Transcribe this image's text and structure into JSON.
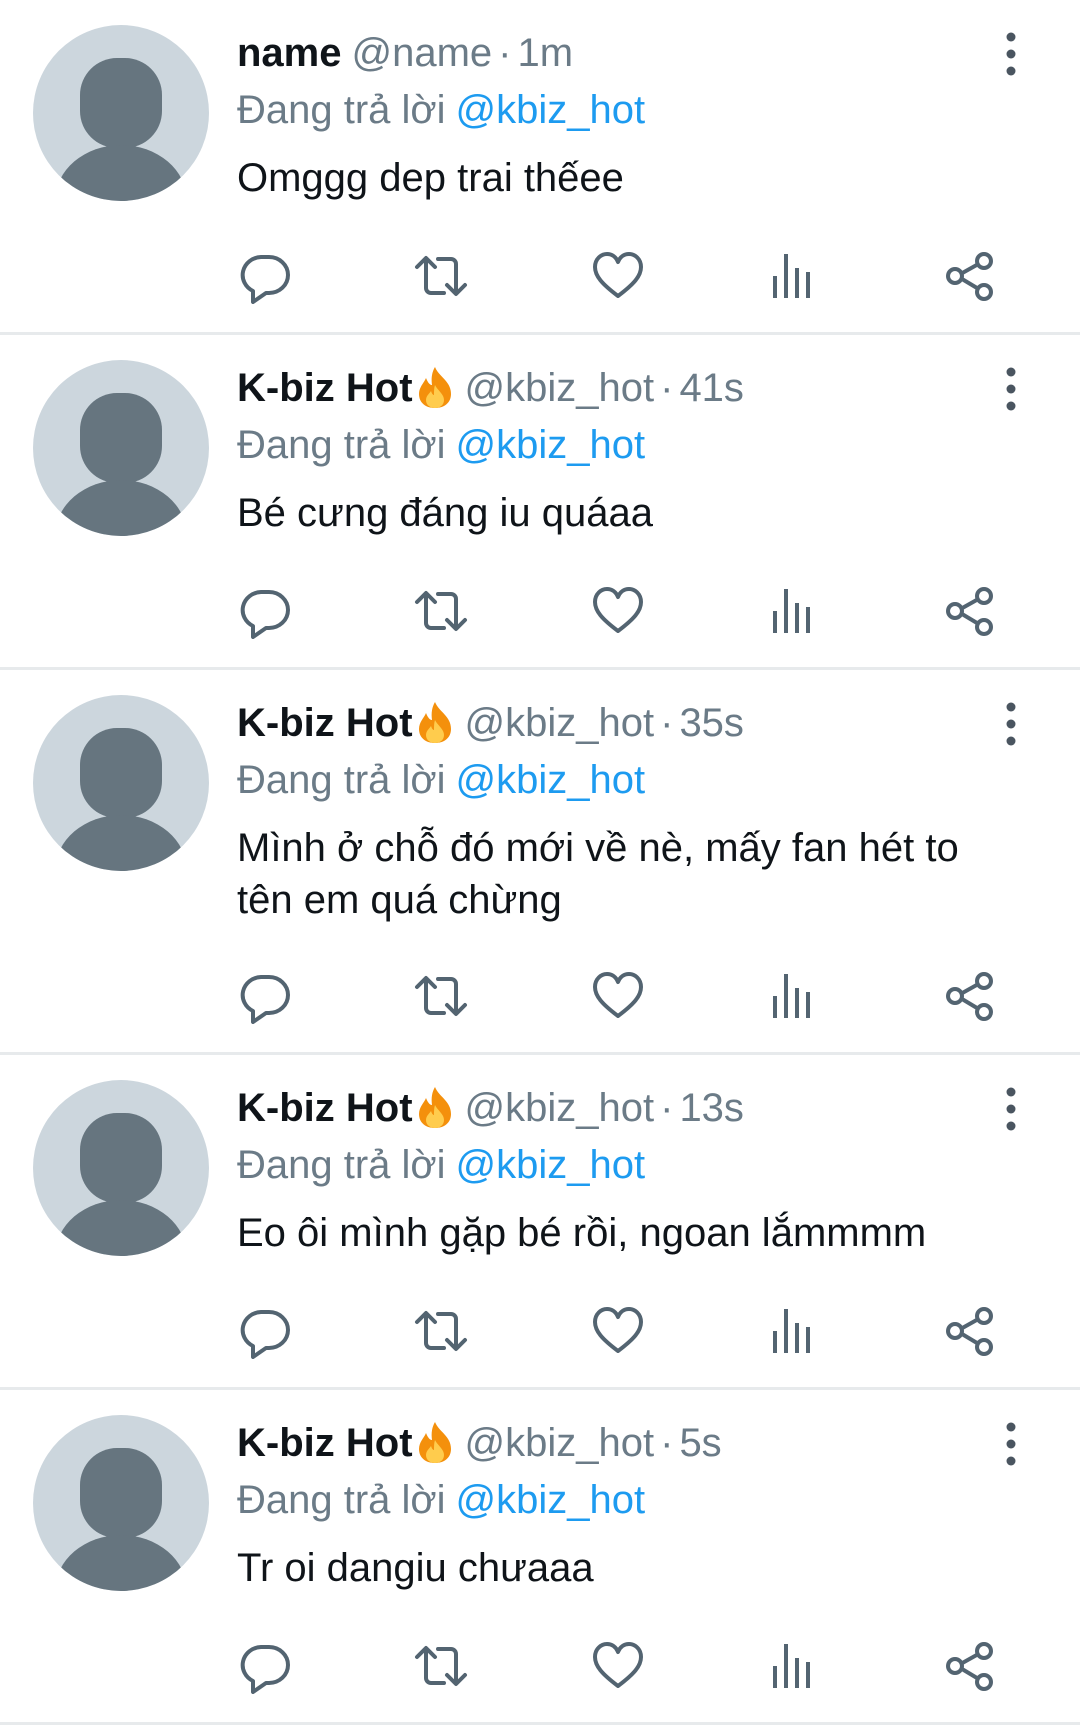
{
  "tweets": [
    {
      "display_name": "name",
      "has_fire": false,
      "handle": "@name",
      "separator": "·",
      "time": "1m",
      "reply_prefix": "Đang trả lời",
      "reply_to": "@kbiz_hot",
      "text": "Omggg dep trai thếee"
    },
    {
      "display_name": "K-biz Hot",
      "has_fire": true,
      "handle": "@kbiz_hot",
      "separator": "·",
      "time": "41s",
      "reply_prefix": "Đang trả lời",
      "reply_to": "@kbiz_hot",
      "text": "Bé cưng đáng iu quáaa"
    },
    {
      "display_name": "K-biz Hot",
      "has_fire": true,
      "handle": "@kbiz_hot",
      "separator": "·",
      "time": "35s",
      "reply_prefix": "Đang trả lời",
      "reply_to": "@kbiz_hot",
      "text": "Mình ở chỗ đó mới về nè, mấy fan hét to tên em quá chừng"
    },
    {
      "display_name": "K-biz Hot",
      "has_fire": true,
      "handle": "@kbiz_hot",
      "separator": "·",
      "time": "13s",
      "reply_prefix": "Đang trả lời",
      "reply_to": "@kbiz_hot",
      "text": "Eo ôi mình gặp bé rồi, ngoan lắmmmm"
    },
    {
      "display_name": "K-biz Hot",
      "has_fire": true,
      "handle": "@kbiz_hot",
      "separator": "·",
      "time": "5s",
      "reply_prefix": "Đang trả lời",
      "reply_to": "@kbiz_hot",
      "text": "Tr oi dangiu chưaaa"
    }
  ],
  "icons": {
    "avatar": "default-avatar-icon",
    "fire": "fire-emoji-icon",
    "more": "more-options-icon",
    "reply": "reply-icon",
    "retweet": "retweet-icon",
    "like": "like-icon",
    "views": "views-icon",
    "share": "share-icon"
  },
  "colors": {
    "text": "#0f1419",
    "secondary": "#6b7b87",
    "link": "#1d9bf0",
    "avatar_bg": "#ccd6dd",
    "avatar_fg": "#66757f",
    "divider": "#e7eaec",
    "fire": "#f4900c"
  }
}
